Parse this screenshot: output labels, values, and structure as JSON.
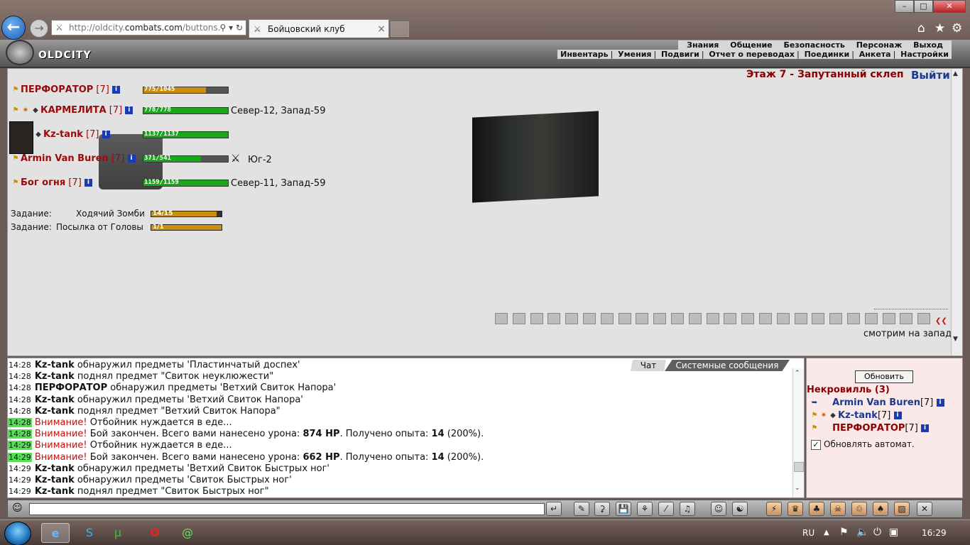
{
  "browser": {
    "url_prefix": "http://oldcity.",
    "url_domain": "combats.com",
    "url_rest": "/buttons.",
    "tab_title": "Бойцовский клуб",
    "tab_close": "×"
  },
  "site": {
    "logo_text": "OLDCITY",
    "nav_top": [
      "Знания",
      "Общение",
      "Безопасность",
      "Персонаж",
      "Выход"
    ],
    "nav_bottom": [
      "Инвентарь",
      "Умения",
      "Подвиги",
      "Отчет о переводах",
      "Поединки",
      "Анкета",
      "Настройки"
    ]
  },
  "room": {
    "floor": "Этаж 7 - Запутанный склеп",
    "exit": "Выйти",
    "view_direction": "смотрим на запад"
  },
  "players": [
    {
      "name": "ПЕРФОРАТОР",
      "level": "[7]",
      "hp_text": "775/1045",
      "hp_frac": 0.74,
      "color": "#c8900c",
      "coords": ""
    },
    {
      "name": "КАРМЕЛИТА",
      "level": "[7]",
      "hp_text": "778/778",
      "hp_frac": 1.0,
      "color": "#1aa81a",
      "coords": "Север-12, Запад-59"
    },
    {
      "name": "Kz-tank",
      "level": "[7]",
      "hp_text": "1137/1137",
      "hp_frac": 1.0,
      "color": "#1aa81a",
      "coords": ""
    },
    {
      "name": "Armin Van Buren",
      "level": "[7]",
      "hp_text": "371/541",
      "hp_frac": 0.68,
      "color": "#1aa81a",
      "coords": "Юг-2"
    },
    {
      "name": "Бог огня",
      "level": "[7]",
      "hp_text": "1159/1159",
      "hp_frac": 1.0,
      "color": "#1aa81a",
      "coords": "Север-11, Запад-59"
    }
  ],
  "tasks": [
    {
      "label": "Задание:",
      "name": "Ходячий Зомби",
      "progress": "14/15",
      "frac": 0.93
    },
    {
      "label": "Задание:",
      "name": "Посылка от Головы",
      "progress": "1/1",
      "frac": 1.0
    }
  ],
  "chat": {
    "tabs": [
      "Чат",
      "Системные сообщения"
    ],
    "lines": [
      {
        "time": "14:28",
        "green": false,
        "who": "Kz-tank",
        "text": " обнаружил предметы 'Пластинчатый доспех'"
      },
      {
        "time": "14:28",
        "green": false,
        "who": "Kz-tank",
        "text": " поднял предмет \"Свиток неуклюжести\""
      },
      {
        "time": "14:28",
        "green": false,
        "who": "ПЕРФОРАТОР",
        "text": " обнаружил предметы 'Ветхий Свиток Напора'"
      },
      {
        "time": "14:28",
        "green": false,
        "who": "Kz-tank",
        "text": " обнаружил предметы 'Ветхий Свиток Напора'"
      },
      {
        "time": "14:28",
        "green": false,
        "who": "Kz-tank",
        "text": " поднял предмет \"Ветхий Свиток Напора\""
      },
      {
        "time": "14:28",
        "green": true,
        "warn": "Внимание!",
        "text": " Отбойник нуждается в еде..."
      },
      {
        "time": "14:28",
        "green": true,
        "warn": "Внимание!",
        "text": " Бой закончен. Всего вами нанесено урона: ",
        "b1": "874 HP",
        "text2": ". Получено опыта: ",
        "b2": "14",
        "text3": " (200%)."
      },
      {
        "time": "14:29",
        "green": true,
        "warn": "Внимание!",
        "text": " Отбойник нуждается в еде..."
      },
      {
        "time": "14:29",
        "green": true,
        "warn": "Внимание!",
        "text": " Бой закончен. Всего вами нанесено урона: ",
        "b1": "662 HP",
        "text2": ". Получено опыта: ",
        "b2": "14",
        "text3": " (200%)."
      },
      {
        "time": "14:29",
        "green": false,
        "who": "Kz-tank",
        "text": " обнаружил предметы 'Ветхий Свиток Быстрых ног'"
      },
      {
        "time": "14:29",
        "green": false,
        "who": "Kz-tank",
        "text": " обнаружил предметы 'Свиток Быстрых ног'"
      },
      {
        "time": "14:29",
        "green": false,
        "who": "Kz-tank",
        "text": " поднял предмет \"Свиток Быстрых ног\""
      }
    ]
  },
  "panel": {
    "refresh": "Обновить",
    "location": "Некровилль (3)",
    "people": [
      {
        "name": "Armin Van Buren",
        "level": "[7]"
      },
      {
        "name": "Kz-tank",
        "level": "[7]"
      },
      {
        "name": "ПЕРФОРАТОР",
        "level": "[7]"
      }
    ],
    "auto_refresh": "Обновлять автомат.",
    "checkmark": "✓"
  },
  "tray": {
    "lang": "RU",
    "clock": "16:29"
  }
}
